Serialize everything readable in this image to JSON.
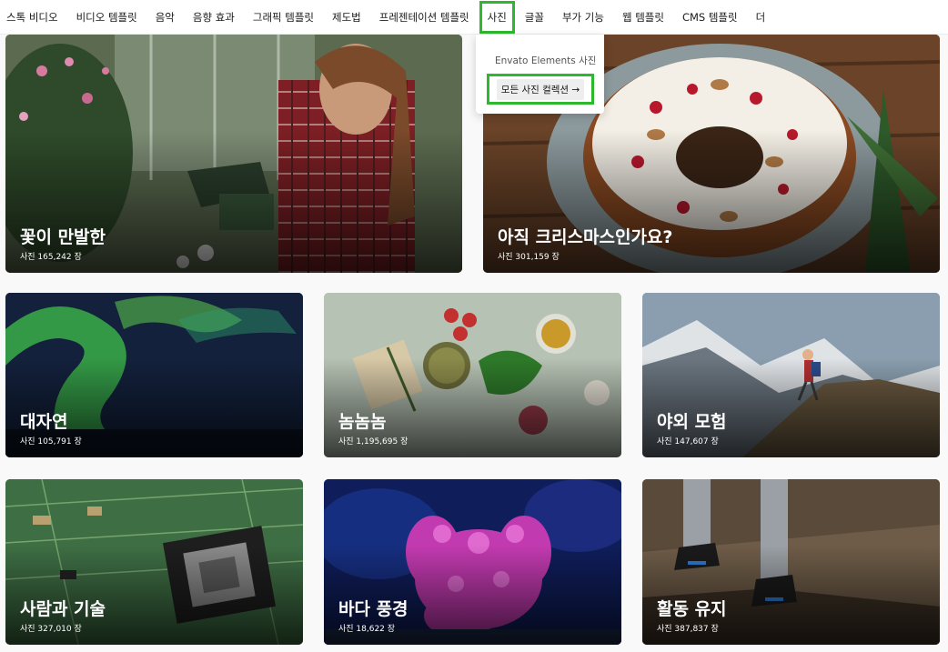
{
  "nav": {
    "items": [
      "스톡 비디오",
      "비디오 템플릿",
      "음악",
      "음향 효과",
      "그래픽 템플릿",
      "제도법",
      "프레젠테이션 템플릿",
      "사진",
      "글꼴",
      "부가 기능",
      "웹 템플릿",
      "CMS 템플릿",
      "더"
    ],
    "active_index": 7
  },
  "dropdown": {
    "title": "Envato Elements 사진",
    "button": "모든 사진 컬렉션 →"
  },
  "cards": [
    {
      "title": "꽃이 만발한",
      "count": "사진 165,242 장"
    },
    {
      "title": "아직 크리스마스인가요?",
      "count": "사진 301,159 장"
    },
    {
      "title": "대자연",
      "count": "사진 105,791 장"
    },
    {
      "title": "놈놈놈",
      "count": "사진 1,195,695 장"
    },
    {
      "title": "야외 모험",
      "count": "사진 147,607 장"
    },
    {
      "title": "사람과 기술",
      "count": "사진 327,010 장"
    },
    {
      "title": "바다 풍경",
      "count": "사진 18,622 장"
    },
    {
      "title": "활동 유지",
      "count": "사진 387,837 장"
    }
  ],
  "colors": {
    "highlight": "#2eb82e"
  }
}
